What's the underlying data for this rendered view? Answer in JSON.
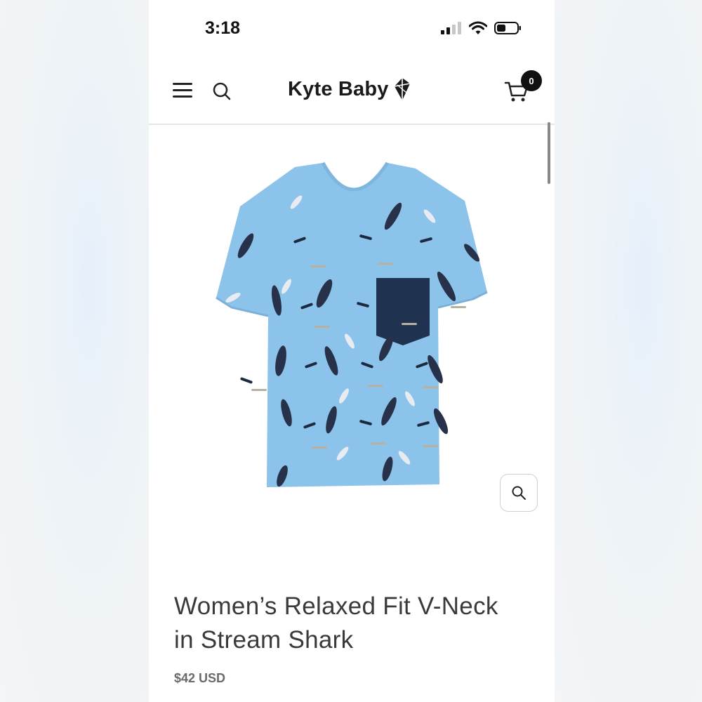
{
  "status_bar": {
    "time": "3:18"
  },
  "header": {
    "brand": "Kyte Baby",
    "cart_count": "0",
    "icons": [
      "menu-icon",
      "search-icon",
      "kite-icon",
      "cart-icon"
    ]
  },
  "product": {
    "title_line1": "Women’s Relaxed Fit V-Neck",
    "title_line2": "in Stream Shark",
    "price": "$42 USD",
    "image_icon": "shark-print-shirt",
    "colors": {
      "shirt": "#8cc3ea",
      "pocket": "#1f3350"
    }
  },
  "zoom": {
    "icon": "magnifier-icon"
  }
}
